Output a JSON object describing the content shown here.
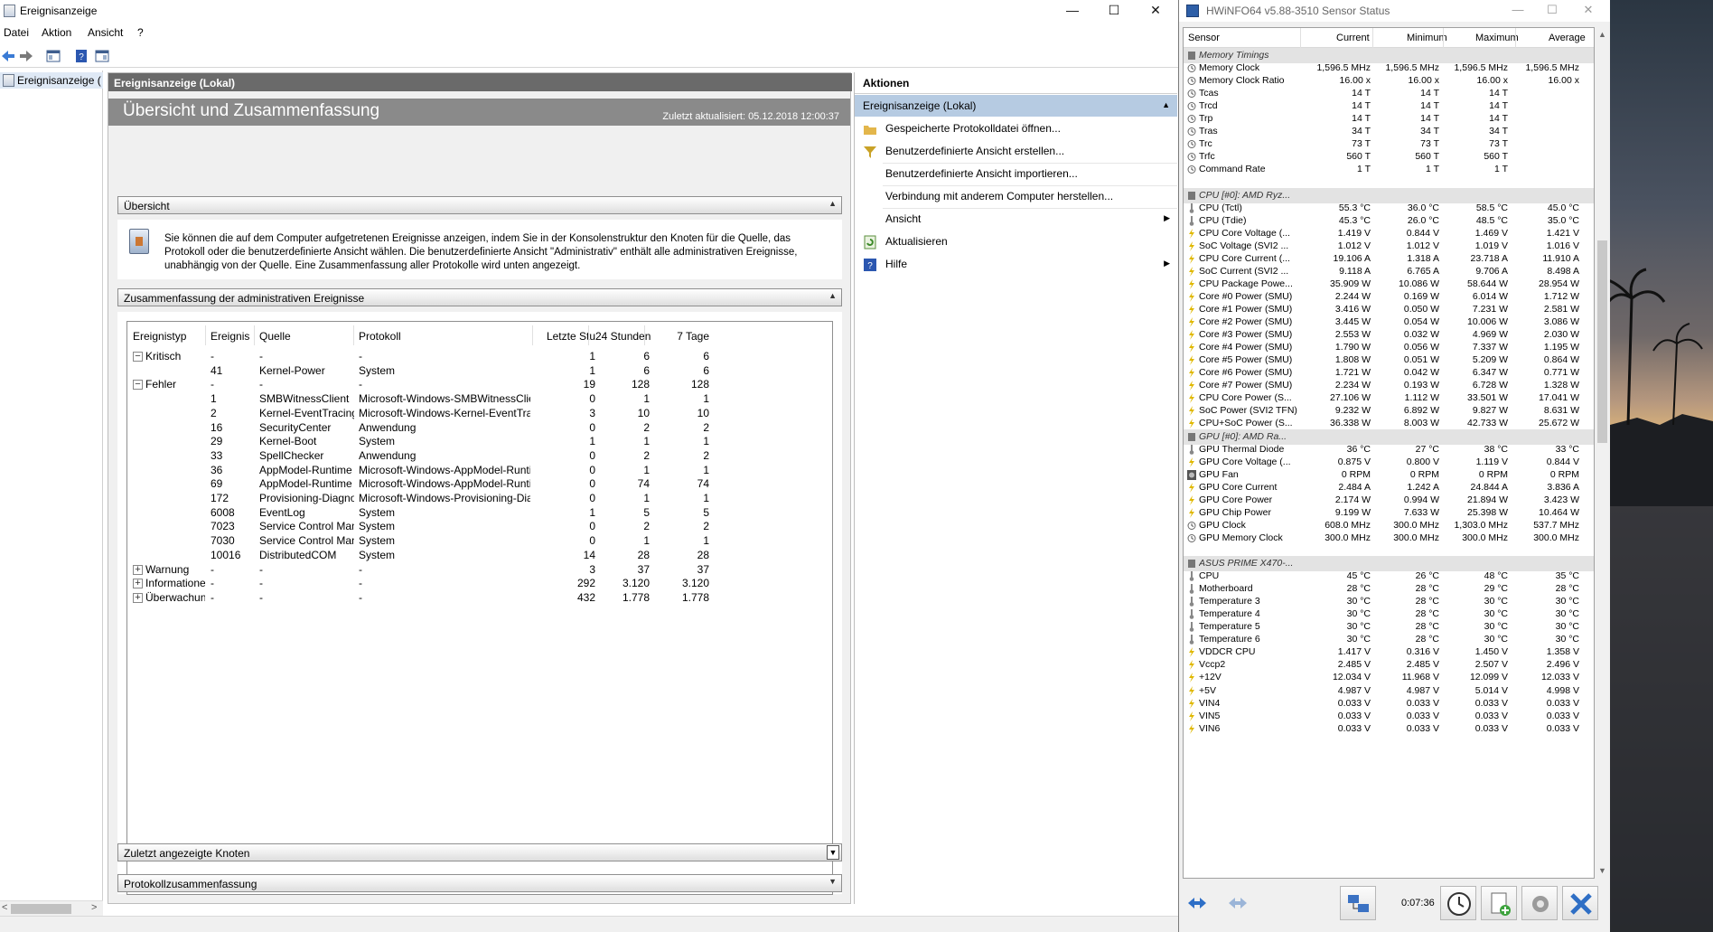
{
  "event_viewer": {
    "window_title": "Ereignisanzeige",
    "menu": [
      "Datei",
      "Aktion",
      "Ansicht",
      "?"
    ],
    "tree_node": "Ereignisanzeige (Lokal)",
    "center": {
      "header": "Ereignisanzeige (Lokal)",
      "banner_title": "Übersicht und Zusammenfassung",
      "last_updated": "Zuletzt aktualisiert: 05.12.2018 12:00:37",
      "section_overview": "Übersicht",
      "overview_text": "Sie können die auf dem Computer aufgetretenen Ereignisse anzeigen, indem Sie in der Konsolenstruktur den Knoten für die Quelle, das Protokoll oder die benutzerdefinierte Ansicht wählen. Die benutzerdefinierte Ansicht \"Administrativ\" enthält alle administrativen Ereignisse, unabhängig von der Quelle. Eine Zusammenfassung aller Protokolle wird unten angezeigt.",
      "section_summary": "Zusammenfassung der administrativen Ereignisse",
      "columns": [
        "Ereignistyp",
        "Ereignis",
        "Quelle",
        "Protokoll",
        "Letzte Stu",
        "24 Stunden",
        "7 Tage"
      ],
      "rows": [
        {
          "type": "Kritisch",
          "expander": "−",
          "id": "-",
          "source": "-",
          "log": "-",
          "h1": "1",
          "h24": "6",
          "d7": "6"
        },
        {
          "type": "",
          "expander": "",
          "id": "41",
          "source": "Kernel-Power",
          "log": "System",
          "h1": "1",
          "h24": "6",
          "d7": "6"
        },
        {
          "type": "Fehler",
          "expander": "−",
          "id": "-",
          "source": "-",
          "log": "-",
          "h1": "19",
          "h24": "128",
          "d7": "128"
        },
        {
          "type": "",
          "expander": "",
          "id": "1",
          "source": "SMBWitnessClient",
          "log": "Microsoft-Windows-SMBWitnessClient/...",
          "h1": "0",
          "h24": "1",
          "d7": "1"
        },
        {
          "type": "",
          "expander": "",
          "id": "2",
          "source": "Kernel-EventTracing",
          "log": "Microsoft-Windows-Kernel-EventTracing...",
          "h1": "3",
          "h24": "10",
          "d7": "10"
        },
        {
          "type": "",
          "expander": "",
          "id": "16",
          "source": "SecurityCenter",
          "log": "Anwendung",
          "h1": "0",
          "h24": "2",
          "d7": "2"
        },
        {
          "type": "",
          "expander": "",
          "id": "29",
          "source": "Kernel-Boot",
          "log": "System",
          "h1": "1",
          "h24": "1",
          "d7": "1"
        },
        {
          "type": "",
          "expander": "",
          "id": "33",
          "source": "SpellChecker",
          "log": "Anwendung",
          "h1": "0",
          "h24": "2",
          "d7": "2"
        },
        {
          "type": "",
          "expander": "",
          "id": "36",
          "source": "AppModel-Runtime",
          "log": "Microsoft-Windows-AppModel-Runtime...",
          "h1": "0",
          "h24": "1",
          "d7": "1"
        },
        {
          "type": "",
          "expander": "",
          "id": "69",
          "source": "AppModel-Runtime",
          "log": "Microsoft-Windows-AppModel-Runtime...",
          "h1": "0",
          "h24": "74",
          "d7": "74"
        },
        {
          "type": "",
          "expander": "",
          "id": "172",
          "source": "Provisioning-Diagno...",
          "log": "Microsoft-Windows-Provisioning-Diagn...",
          "h1": "0",
          "h24": "1",
          "d7": "1"
        },
        {
          "type": "",
          "expander": "",
          "id": "6008",
          "source": "EventLog",
          "log": "System",
          "h1": "1",
          "h24": "5",
          "d7": "5"
        },
        {
          "type": "",
          "expander": "",
          "id": "7023",
          "source": "Service Control Man...",
          "log": "System",
          "h1": "0",
          "h24": "2",
          "d7": "2"
        },
        {
          "type": "",
          "expander": "",
          "id": "7030",
          "source": "Service Control Man...",
          "log": "System",
          "h1": "0",
          "h24": "1",
          "d7": "1"
        },
        {
          "type": "",
          "expander": "",
          "id": "10016",
          "source": "DistributedCOM",
          "log": "System",
          "h1": "14",
          "h24": "28",
          "d7": "28"
        },
        {
          "type": "Warnung",
          "expander": "+",
          "id": "-",
          "source": "-",
          "log": "-",
          "h1": "3",
          "h24": "37",
          "d7": "37"
        },
        {
          "type": "Informationen",
          "expander": "+",
          "id": "-",
          "source": "-",
          "log": "-",
          "h1": "292",
          "h24": "3.120",
          "d7": "3.120"
        },
        {
          "type": "Überwachun...",
          "expander": "+",
          "id": "-",
          "source": "-",
          "log": "-",
          "h1": "432",
          "h24": "1.778",
          "d7": "1.778"
        }
      ],
      "section_recent": "Zuletzt angezeigte Knoten",
      "section_logs": "Protokollzusammenfassung"
    },
    "actions": {
      "header": "Aktionen",
      "selected": "Ereignisanzeige (Lokal)",
      "items": [
        {
          "label": "Gespeicherte Protokolldatei öffnen...",
          "icon": "folder-icon",
          "submenu": false
        },
        {
          "label": "Benutzerdefinierte Ansicht erstellen...",
          "icon": "filter-icon",
          "submenu": false
        },
        {
          "label": "Benutzerdefinierte Ansicht importieren...",
          "icon": "",
          "submenu": false
        },
        {
          "label": "Verbindung mit anderem Computer herstellen...",
          "icon": "",
          "submenu": false
        },
        {
          "label": "Ansicht",
          "icon": "",
          "submenu": true
        },
        {
          "label": "Aktualisieren",
          "icon": "refresh-icon",
          "submenu": false
        },
        {
          "label": "Hilfe",
          "icon": "help-icon",
          "submenu": true
        }
      ]
    }
  },
  "hwinfo": {
    "window_title": "HWiNFO64 v5.88-3510 Sensor Status",
    "columns": [
      "Sensor",
      "Current",
      "Minimum",
      "Maximum",
      "Average"
    ],
    "timer": "0:07:36",
    "rows": [
      {
        "g": true,
        "name": "Memory Timings"
      },
      {
        "name": "Memory Clock",
        "icon": "clock",
        "cur": "1,596.5 MHz",
        "min": "1,596.5 MHz",
        "max": "1,596.5 MHz",
        "avg": "1,596.5 MHz"
      },
      {
        "name": "Memory Clock Ratio",
        "icon": "clock",
        "cur": "16.00 x",
        "min": "16.00 x",
        "max": "16.00 x",
        "avg": "16.00 x"
      },
      {
        "name": "Tcas",
        "icon": "clock",
        "cur": "14 T",
        "min": "14 T",
        "max": "14 T",
        "avg": ""
      },
      {
        "name": "Trcd",
        "icon": "clock",
        "cur": "14 T",
        "min": "14 T",
        "max": "14 T",
        "avg": ""
      },
      {
        "name": "Trp",
        "icon": "clock",
        "cur": "14 T",
        "min": "14 T",
        "max": "14 T",
        "avg": ""
      },
      {
        "name": "Tras",
        "icon": "clock",
        "cur": "34 T",
        "min": "34 T",
        "max": "34 T",
        "avg": ""
      },
      {
        "name": "Trc",
        "icon": "clock",
        "cur": "73 T",
        "min": "73 T",
        "max": "73 T",
        "avg": ""
      },
      {
        "name": "Trfc",
        "icon": "clock",
        "cur": "560 T",
        "min": "560 T",
        "max": "560 T",
        "avg": ""
      },
      {
        "name": "Command Rate",
        "icon": "clock",
        "cur": "1 T",
        "min": "1 T",
        "max": "1 T",
        "avg": ""
      },
      {
        "blank": true
      },
      {
        "g": true,
        "name": "CPU [#0]: AMD Ryz..."
      },
      {
        "name": "CPU (Tctl)",
        "icon": "therm",
        "cur": "55.3 °C",
        "min": "36.0 °C",
        "max": "58.5 °C",
        "avg": "45.0 °C"
      },
      {
        "name": "CPU (Tdie)",
        "icon": "therm",
        "cur": "45.3 °C",
        "min": "26.0 °C",
        "max": "48.5 °C",
        "avg": "35.0 °C"
      },
      {
        "name": "CPU Core Voltage (...",
        "icon": "bolt",
        "cur": "1.419 V",
        "min": "0.844 V",
        "max": "1.469 V",
        "avg": "1.421 V"
      },
      {
        "name": "SoC Voltage (SVI2 ...",
        "icon": "bolt",
        "cur": "1.012 V",
        "min": "1.012 V",
        "max": "1.019 V",
        "avg": "1.016 V"
      },
      {
        "name": "CPU Core Current (...",
        "icon": "bolt",
        "cur": "19.106 A",
        "min": "1.318 A",
        "max": "23.718 A",
        "avg": "11.910 A"
      },
      {
        "name": "SoC Current (SVI2 ...",
        "icon": "bolt",
        "cur": "9.118 A",
        "min": "6.765 A",
        "max": "9.706 A",
        "avg": "8.498 A"
      },
      {
        "name": "CPU Package Powe...",
        "icon": "bolt",
        "cur": "35.909 W",
        "min": "10.086 W",
        "max": "58.644 W",
        "avg": "28.954 W"
      },
      {
        "name": "Core #0 Power (SMU)",
        "icon": "bolt",
        "cur": "2.244 W",
        "min": "0.169 W",
        "max": "6.014 W",
        "avg": "1.712 W"
      },
      {
        "name": "Core #1 Power (SMU)",
        "icon": "bolt",
        "cur": "3.416 W",
        "min": "0.050 W",
        "max": "7.231 W",
        "avg": "2.581 W"
      },
      {
        "name": "Core #2 Power (SMU)",
        "icon": "bolt",
        "cur": "3.445 W",
        "min": "0.054 W",
        "max": "10.006 W",
        "avg": "3.086 W"
      },
      {
        "name": "Core #3 Power (SMU)",
        "icon": "bolt",
        "cur": "2.553 W",
        "min": "0.032 W",
        "max": "4.969 W",
        "avg": "2.030 W"
      },
      {
        "name": "Core #4 Power (SMU)",
        "icon": "bolt",
        "cur": "1.790 W",
        "min": "0.056 W",
        "max": "7.337 W",
        "avg": "1.195 W"
      },
      {
        "name": "Core #5 Power (SMU)",
        "icon": "bolt",
        "cur": "1.808 W",
        "min": "0.051 W",
        "max": "5.209 W",
        "avg": "0.864 W"
      },
      {
        "name": "Core #6 Power (SMU)",
        "icon": "bolt",
        "cur": "1.721 W",
        "min": "0.042 W",
        "max": "6.347 W",
        "avg": "0.771 W"
      },
      {
        "name": "Core #7 Power (SMU)",
        "icon": "bolt",
        "cur": "2.234 W",
        "min": "0.193 W",
        "max": "6.728 W",
        "avg": "1.328 W"
      },
      {
        "name": "CPU Core Power (S...",
        "icon": "bolt",
        "cur": "27.106 W",
        "min": "1.112 W",
        "max": "33.501 W",
        "avg": "17.041 W"
      },
      {
        "name": "SoC Power (SVI2 TFN)",
        "icon": "bolt",
        "cur": "9.232 W",
        "min": "6.892 W",
        "max": "9.827 W",
        "avg": "8.631 W"
      },
      {
        "name": "CPU+SoC Power (S...",
        "icon": "bolt",
        "cur": "36.338 W",
        "min": "8.003 W",
        "max": "42.733 W",
        "avg": "25.672 W"
      },
      {
        "g": true,
        "name": "GPU [#0]: AMD Ra..."
      },
      {
        "name": "GPU Thermal Diode",
        "icon": "therm",
        "cur": "36 °C",
        "min": "27 °C",
        "max": "38 °C",
        "avg": "33 °C"
      },
      {
        "name": "GPU Core Voltage (...",
        "icon": "bolt",
        "cur": "0.875 V",
        "min": "0.800 V",
        "max": "1.119 V",
        "avg": "0.844 V"
      },
      {
        "name": "GPU Fan",
        "icon": "fan",
        "cur": "0 RPM",
        "min": "0 RPM",
        "max": "0 RPM",
        "avg": "0 RPM"
      },
      {
        "name": "GPU Core Current",
        "icon": "bolt",
        "cur": "2.484 A",
        "min": "1.242 A",
        "max": "24.844 A",
        "avg": "3.836 A"
      },
      {
        "name": "GPU Core Power",
        "icon": "bolt",
        "cur": "2.174 W",
        "min": "0.994 W",
        "max": "21.894 W",
        "avg": "3.423 W"
      },
      {
        "name": "GPU Chip Power",
        "icon": "bolt",
        "cur": "9.199 W",
        "min": "7.633 W",
        "max": "25.398 W",
        "avg": "10.464 W"
      },
      {
        "name": "GPU Clock",
        "icon": "clock",
        "cur": "608.0 MHz",
        "min": "300.0 MHz",
        "max": "1,303.0 MHz",
        "avg": "537.7 MHz"
      },
      {
        "name": "GPU Memory Clock",
        "icon": "clock",
        "cur": "300.0 MHz",
        "min": "300.0 MHz",
        "max": "300.0 MHz",
        "avg": "300.0 MHz"
      },
      {
        "blank": true
      },
      {
        "g": true,
        "name": "ASUS PRIME X470-..."
      },
      {
        "name": "CPU",
        "icon": "therm",
        "cur": "45 °C",
        "min": "26 °C",
        "max": "48 °C",
        "avg": "35 °C"
      },
      {
        "name": "Motherboard",
        "icon": "therm",
        "cur": "28 °C",
        "min": "28 °C",
        "max": "29 °C",
        "avg": "28 °C"
      },
      {
        "name": "Temperature 3",
        "icon": "therm",
        "cur": "30 °C",
        "min": "28 °C",
        "max": "30 °C",
        "avg": "30 °C"
      },
      {
        "name": "Temperature 4",
        "icon": "therm",
        "cur": "30 °C",
        "min": "28 °C",
        "max": "30 °C",
        "avg": "30 °C"
      },
      {
        "name": "Temperature 5",
        "icon": "therm",
        "cur": "30 °C",
        "min": "28 °C",
        "max": "30 °C",
        "avg": "30 °C"
      },
      {
        "name": "Temperature 6",
        "icon": "therm",
        "cur": "30 °C",
        "min": "28 °C",
        "max": "30 °C",
        "avg": "30 °C"
      },
      {
        "name": "VDDCR CPU",
        "icon": "bolt",
        "cur": "1.417 V",
        "min": "0.316 V",
        "max": "1.450 V",
        "avg": "1.358 V"
      },
      {
        "name": "Vccp2",
        "icon": "bolt",
        "cur": "2.485 V",
        "min": "2.485 V",
        "max": "2.507 V",
        "avg": "2.496 V"
      },
      {
        "name": "+12V",
        "icon": "bolt",
        "cur": "12.034 V",
        "min": "11.968 V",
        "max": "12.099 V",
        "avg": "12.033 V"
      },
      {
        "name": "+5V",
        "icon": "bolt",
        "cur": "4.987 V",
        "min": "4.987 V",
        "max": "5.014 V",
        "avg": "4.998 V"
      },
      {
        "name": "VIN4",
        "icon": "bolt",
        "cur": "0.033 V",
        "min": "0.033 V",
        "max": "0.033 V",
        "avg": "0.033 V"
      },
      {
        "name": "VIN5",
        "icon": "bolt",
        "cur": "0.033 V",
        "min": "0.033 V",
        "max": "0.033 V",
        "avg": "0.033 V"
      },
      {
        "name": "VIN6",
        "icon": "bolt",
        "cur": "0.033 V",
        "min": "0.033 V",
        "max": "0.033 V",
        "avg": "0.033 V"
      }
    ]
  }
}
